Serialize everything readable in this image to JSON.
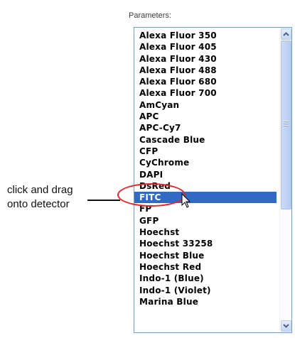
{
  "parameters_label": "Parameters:",
  "parameters": [
    "Alexa Fluor 350",
    "Alexa Fluor 405",
    "Alexa Fluor 430",
    "Alexa Fluor 488",
    "Alexa Fluor 680",
    "Alexa Fluor 700",
    "AmCyan",
    "APC",
    "APC-Cy7",
    "Cascade Blue",
    "CFP",
    "CyChrome",
    "DAPI",
    "DsRed",
    "FITC",
    "FP",
    "GFP",
    "Hoechst",
    "Hoechst 33258",
    "Hoechst Blue",
    "Hoechst Red",
    "Indo-1 (Blue)",
    "Indo-1 (Violet)",
    "Marina Blue"
  ],
  "selected_parameter": "FITC",
  "annotation": {
    "line1": "click and drag",
    "line2": "onto detector"
  },
  "colors": {
    "selection": "#316ac5",
    "highlight_ellipse": "#e8232a"
  },
  "icons": {
    "scroll_up": "chevron-up-icon",
    "scroll_down": "chevron-down-icon",
    "cursor": "arrow-cursor-icon"
  }
}
